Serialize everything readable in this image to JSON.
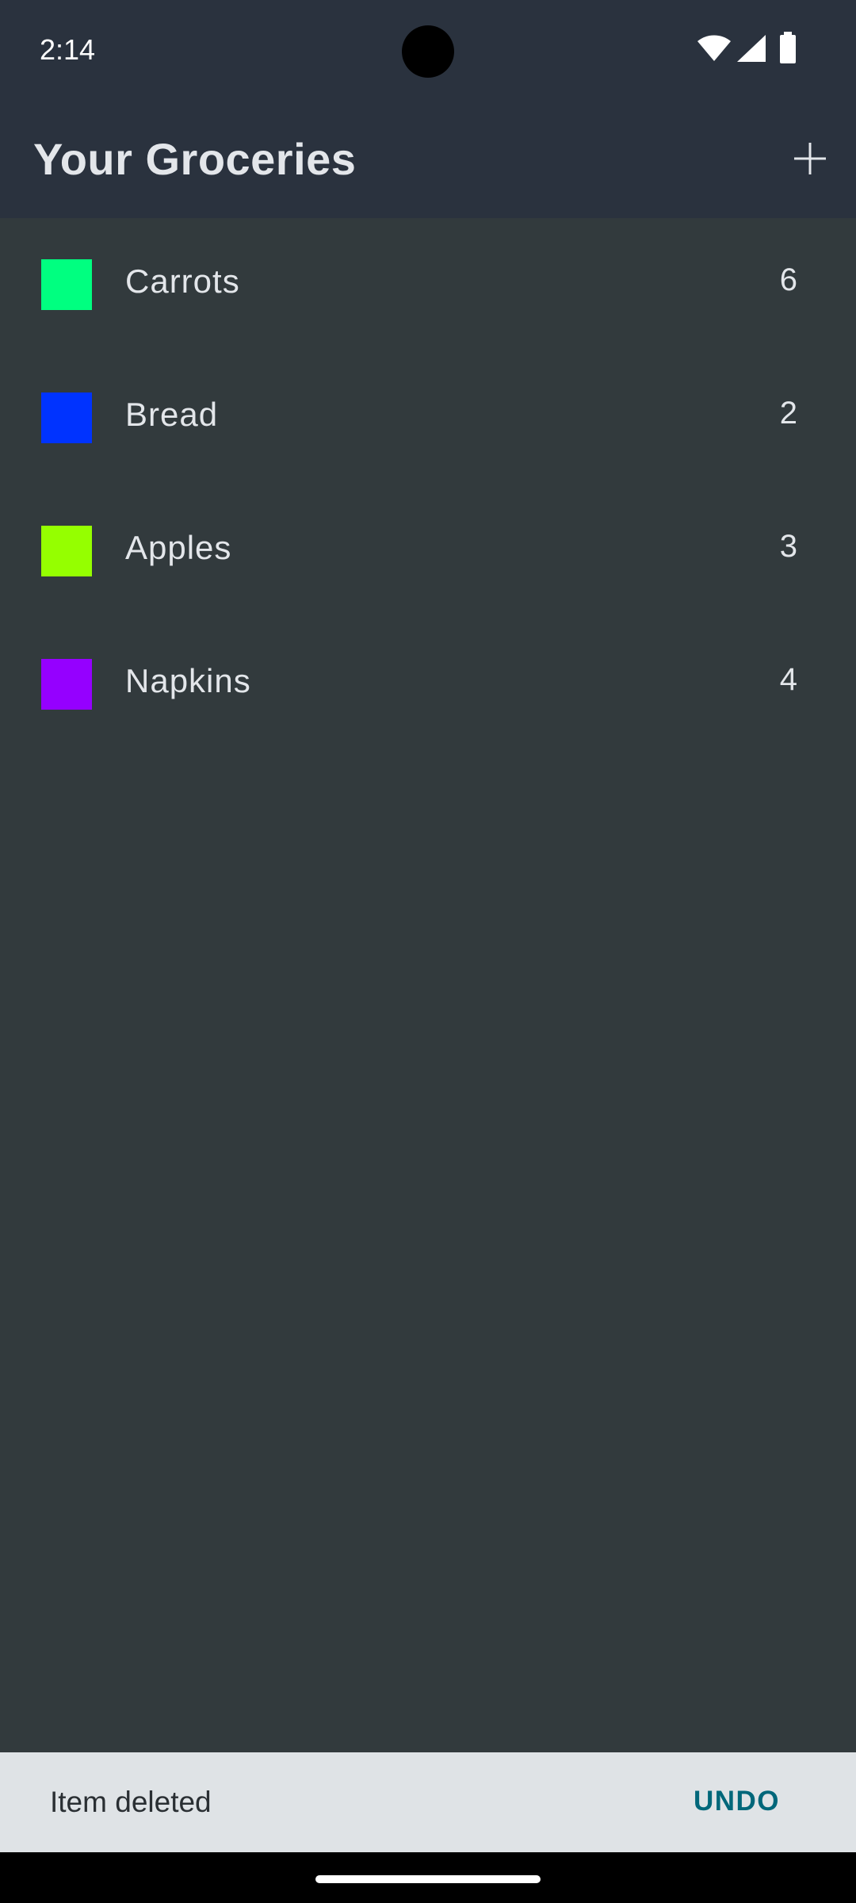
{
  "status_bar": {
    "time": "2:14",
    "icons": [
      "wifi-icon",
      "signal-icon",
      "battery-icon"
    ]
  },
  "app_bar": {
    "title": "Your Groceries",
    "add_icon": "plus-icon"
  },
  "groceries": [
    {
      "name": "Carrots",
      "quantity": "6",
      "color": "#00ff80"
    },
    {
      "name": "Bread",
      "quantity": "2",
      "color": "#0033ff"
    },
    {
      "name": "Apples",
      "quantity": "3",
      "color": "#95ff00"
    },
    {
      "name": "Napkins",
      "quantity": "4",
      "color": "#9500ff"
    }
  ],
  "snackbar": {
    "message": "Item deleted",
    "action_label": "UNDO"
  },
  "colors": {
    "app_bar_bg": "#2a323e",
    "body_bg": "#323a3d",
    "snackbar_bg": "#dfe3e6",
    "snackbar_action": "#00677a"
  }
}
